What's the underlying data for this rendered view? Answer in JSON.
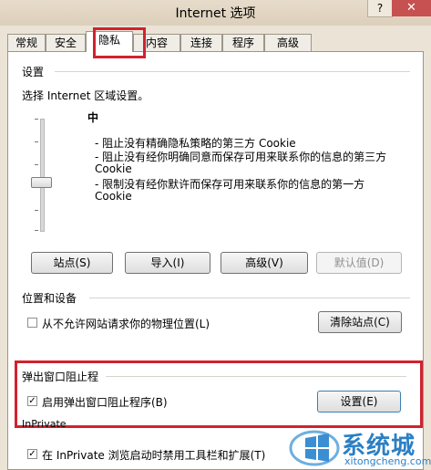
{
  "window": {
    "title": "Internet 选项",
    "help": "?",
    "close": "✕"
  },
  "tabs": [
    "常规",
    "安全",
    "隐私",
    "内容",
    "连接",
    "程序",
    "高级"
  ],
  "settings": {
    "heading": "设置",
    "instruction": "选择 Internet 区域设置。",
    "level": "中",
    "desc1": "- 阻止没有精确隐私策略的第三方 Cookie",
    "desc2": "- 阻止没有经你明确同意而保存可用来联系你的信息的第三方",
    "desc2b": "Cookie",
    "desc3": "- 限制没有经你默许而保存可用来联系你的信息的第一方",
    "desc3b": "Cookie",
    "buttons": {
      "sites": "站点(S)",
      "import": "导入(I)",
      "advanced": "高级(V)",
      "default": "默认值(D)"
    }
  },
  "location": {
    "heading": "位置和设备",
    "checkbox_label": "从不允许网站请求你的物理位置(L)",
    "clear_button": "清除站点(C)"
  },
  "popup": {
    "heading": "弹出窗口阻止程",
    "checkbox_label": "启用弹出窗口阻止程序(B)",
    "settings_button": "设置(E)"
  },
  "inprivate": {
    "heading": "InPrivate",
    "checkbox_label": "在 InPrivate 浏览启动时禁用工具栏和扩展(T)"
  },
  "watermark": {
    "cn": "系统城",
    "url": "xitongcheng.com"
  },
  "colors": {
    "highlight": "#d0222e",
    "window_bg": "#ebe3d6"
  }
}
